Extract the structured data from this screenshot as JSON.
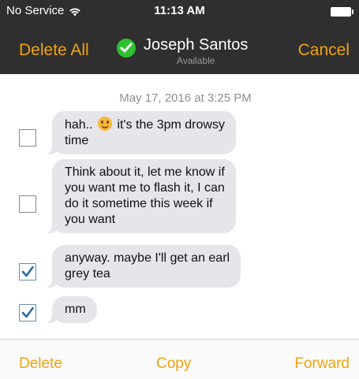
{
  "status_bar": {
    "carrier": "No Service",
    "time": "11:13 AM"
  },
  "nav": {
    "delete_all_label": "Delete All",
    "cancel_label": "Cancel",
    "contact_name": "Joseph Santos",
    "contact_status": "Available"
  },
  "conversation": {
    "timestamp": "May 17, 2016 at 3:25 PM",
    "messages": [
      {
        "text_before": "hah..",
        "text_after": "it's the 3pm drowsy",
        "line2": "time",
        "selected": false
      },
      {
        "lines": [
          "Think about it, let me know if",
          "you want me to flash it, I can",
          "do it sometime this week if",
          "you want"
        ],
        "selected": false
      },
      {
        "lines": [
          "anyway. maybe I'll get an earl",
          "grey tea"
        ],
        "selected": true
      },
      {
        "lines": [
          "mm"
        ],
        "selected": true
      }
    ]
  },
  "toolbar": {
    "delete_label": "Delete",
    "copy_label": "Copy",
    "forward_label": "Forward"
  },
  "colors": {
    "accent": "#f0a30a",
    "bar_background": "#2f2f2f",
    "bubble_background": "#e5e5ea",
    "available_green": "#2fbf2f"
  }
}
